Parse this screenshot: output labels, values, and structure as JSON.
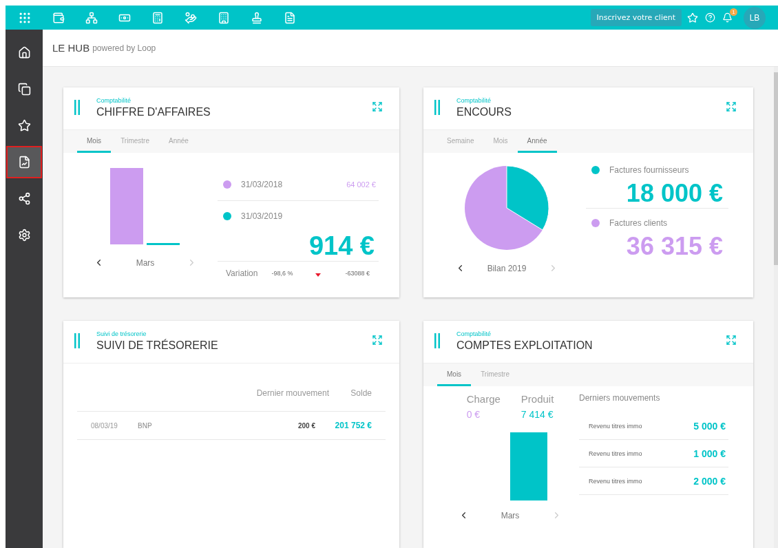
{
  "topbar": {
    "register_button": "Inscrivez votre client",
    "notification_count": "1",
    "avatar": "LB"
  },
  "sidebar": {
    "items": [
      {
        "selected": false,
        "outlined": false
      },
      {
        "selected": false,
        "outlined": false
      },
      {
        "selected": false,
        "outlined": false
      },
      {
        "selected": true,
        "outlined": true
      },
      {
        "selected": false,
        "outlined": false
      },
      {
        "selected": false,
        "outlined": false
      }
    ]
  },
  "header": {
    "title": "LE HUB",
    "subtitle": "powered by Loop"
  },
  "cards": [
    {
      "kind": "revenue",
      "category": "Comptabilité",
      "title": "CHIFFRE D'AFFAIRES",
      "tabs": [
        {
          "label": "Mois",
          "selected": true
        },
        {
          "label": "Trimestre",
          "selected": false
        },
        {
          "label": "Année",
          "selected": false
        }
      ],
      "period": "Mars",
      "rows": [
        {
          "date": "31/03/2018",
          "amount": "64 002 €",
          "color": "#cc9cf0",
          "large": false
        },
        {
          "date": "31/03/2019",
          "amount": "914 €",
          "color": "#00c4c8",
          "large": true
        }
      ],
      "variation": {
        "label": "Variation",
        "percent": "-98,6 %",
        "decreasing": true,
        "delta": "-63088 €"
      }
    },
    {
      "kind": "outstanding",
      "category": "Comptabilité",
      "title": "ENCOURS",
      "tabs": [
        {
          "label": "Semaine",
          "selected": false
        },
        {
          "label": "Mois",
          "selected": false
        },
        {
          "label": "Année",
          "selected": true
        }
      ],
      "period": "Bilan 2019",
      "legend": [
        {
          "label": "Factures fournisseurs",
          "amount": "18 000 €",
          "color": "#00c4c8"
        },
        {
          "label": "Factures clients",
          "amount": "36 315 €",
          "color": "#cc9cf0"
        }
      ]
    },
    {
      "kind": "treasury",
      "category": "Suivi de trésorerie",
      "title": "SUIVI DE TRÉSORERIE",
      "columns": [
        "Dernier mouvement",
        "Solde"
      ],
      "rows": [
        {
          "date": "08/03/19",
          "bank": "BNP",
          "last": "200 €",
          "balance": "201 752 €"
        }
      ]
    },
    {
      "kind": "operating",
      "category": "Comptabilité",
      "title": "COMPTES EXPLOITATION",
      "tabs": [
        {
          "label": "Mois",
          "selected": true
        },
        {
          "label": "Trimestre",
          "selected": false
        }
      ],
      "charge": {
        "label": "Charge",
        "amount": "0 €"
      },
      "product": {
        "label": "Produit",
        "amount": "7 414 €"
      },
      "period": "Mars",
      "movements_title": "Derniers mouvements",
      "movements": [
        {
          "label": "Revenu titres immo",
          "amount": "5 000 €"
        },
        {
          "label": "Revenu titres immo",
          "amount": "1 000 €"
        },
        {
          "label": "Revenu titres immo",
          "amount": "2 000 €"
        }
      ]
    }
  ]
}
